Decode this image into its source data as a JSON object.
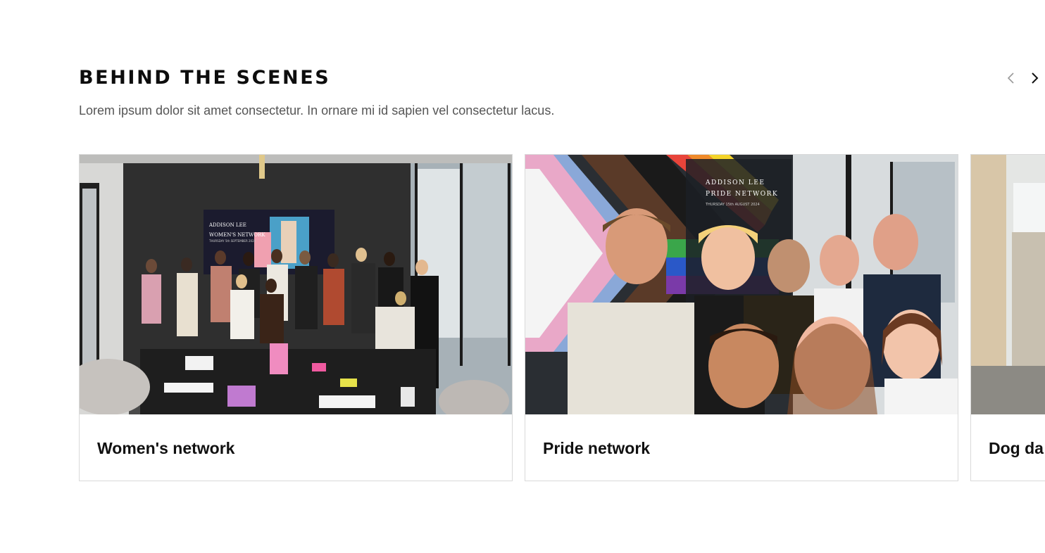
{
  "section": {
    "title": "BEHIND THE SCENES",
    "subtitle": "Lorem ipsum dolor sit amet consectetur. In ornare mi id sapien vel consectetur lacus."
  },
  "navigation": {
    "prev_icon": "chevron-left-icon",
    "next_icon": "chevron-right-icon",
    "prev_color": "#9a9a9a",
    "next_color": "#111111"
  },
  "cards": [
    {
      "label": "Women's network",
      "screen_text": [
        "ADDISON LEE",
        "WOMEN'S NETWORK",
        "THURSDAY 5th SEPTEMBER 2024"
      ]
    },
    {
      "label": "Pride network",
      "screen_text": [
        "ADDISON LEE",
        "PRIDE NETWORK",
        "THURSDAY 15th AUGUST 2024"
      ]
    },
    {
      "label": "Dog da"
    }
  ]
}
